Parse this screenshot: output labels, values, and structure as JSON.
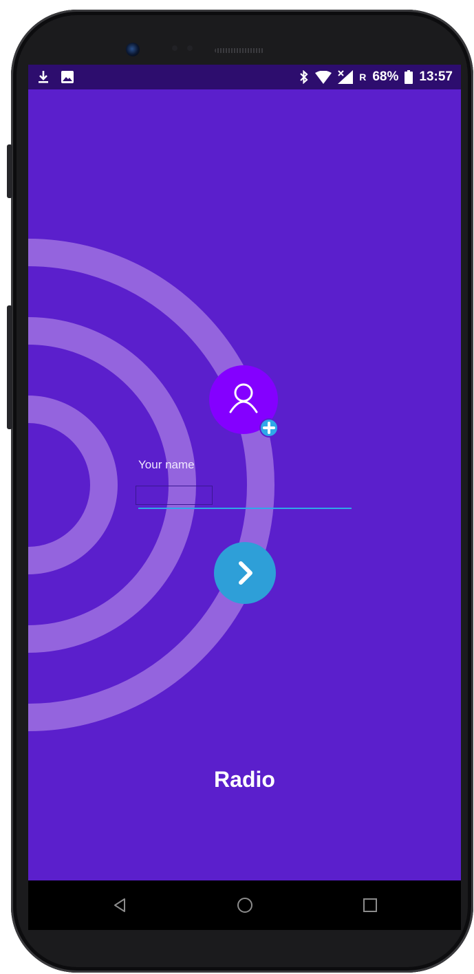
{
  "status_bar": {
    "left_icons": [
      "download-icon",
      "image-icon"
    ],
    "right_icons": [
      "bluetooth-icon",
      "wifi-icon",
      "signal-no-data-icon"
    ],
    "roaming": "R",
    "battery_percent": "68%",
    "time": "13:57"
  },
  "profile": {
    "avatar_icon": "person-icon",
    "add_icon": "plus-icon"
  },
  "form": {
    "name_label": "Your name",
    "name_value": "",
    "next_icon": "chevron-right-icon"
  },
  "app": {
    "title": "Radio"
  },
  "nav_bar": {
    "buttons": [
      "back-icon",
      "home-icon",
      "recents-icon"
    ]
  },
  "colors": {
    "background": "#5b1fcc",
    "status_bar": "#2d0d6e",
    "accent": "#2e9fd8",
    "avatar": "#8400ff",
    "rings": "#9a6be0"
  }
}
